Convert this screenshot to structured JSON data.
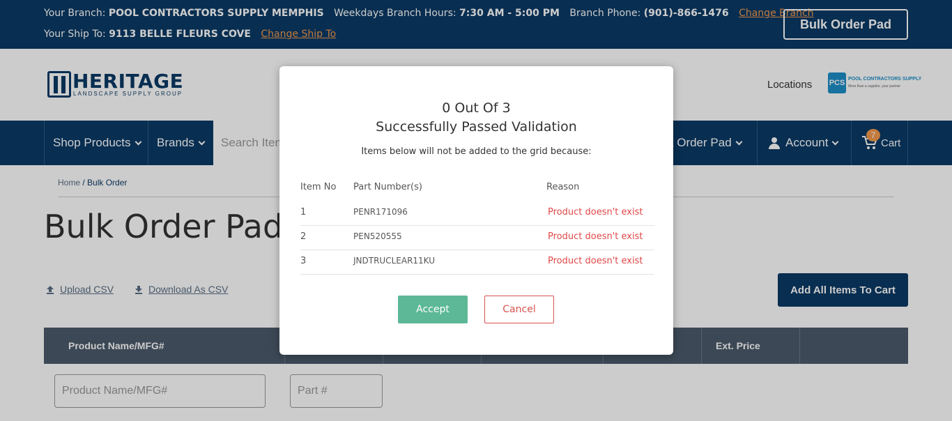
{
  "topbar": {
    "branch_label": "Your Branch:",
    "branch_name": "POOL CONTRACTORS SUPPLY MEMPHIS",
    "hours_label": "Weekdays Branch Hours:",
    "hours_value": "7:30 AM - 5:00 PM",
    "phone_label": "Branch Phone:",
    "phone_value": "(901)-866-1476",
    "change_branch": "Change Branch",
    "shipto_label": "Your Ship To:",
    "shipto_value": "9113 BELLE FLEURS COVE",
    "change_shipto": "Change Ship To",
    "bulk_button": "Bulk Order Pad"
  },
  "header": {
    "logo_word": "HERITAGE",
    "logo_sub": "LANDSCAPE SUPPLY GROUP",
    "locations": "Locations",
    "pcs_badge": "PCS",
    "pcs_title": "POOL CONTRACTORS SUPPLY",
    "pcs_tagline": "More than a supplier, your partner"
  },
  "nav": {
    "shop_products": "Shop Products",
    "brands": "Brands",
    "search_placeholder": "Search Items",
    "bulk_order_pad": "k Order Pad",
    "account": "Account",
    "cart": "Cart",
    "cart_count": "7"
  },
  "breadcrumb": {
    "home": "Home",
    "separator": " / ",
    "current": "Bulk Order"
  },
  "page": {
    "title": "Bulk Order Pad",
    "upload_csv": "Upload CSV",
    "download_csv": "Download As CSV",
    "add_all": "Add All Items To Cart"
  },
  "grid": {
    "col_product": "Product Name/MFG#",
    "col_ext_price": "Ext. Price",
    "product_placeholder": "Product Name/MFG#",
    "part_placeholder": "Part #"
  },
  "modal": {
    "title_line1": "0 Out Of 3",
    "title_line2": "Successfully Passed Validation",
    "subtitle": "Items below will not be added to the grid because:",
    "headers": {
      "item_no": "Item No",
      "part_numbers": "Part Number(s)",
      "reason": "Reason"
    },
    "rows": [
      {
        "no": "1",
        "part": "PENR171096",
        "reason": "Product doesn't exist"
      },
      {
        "no": "2",
        "part": "PEN520555",
        "reason": "Product doesn't exist"
      },
      {
        "no": "3",
        "part": "JNDTRUCLEAR11KU",
        "reason": "Product doesn't exist"
      }
    ],
    "accept": "Accept",
    "cancel": "Cancel"
  },
  "colors": {
    "brand_navy": "#0b3a66",
    "accent_orange": "#f39a4d",
    "accept_green": "#5cb896",
    "error_red": "#e04848"
  }
}
